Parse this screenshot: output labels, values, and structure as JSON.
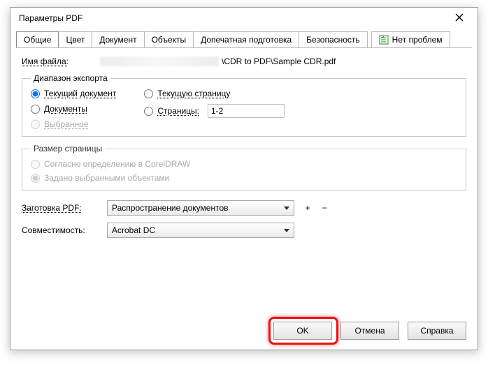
{
  "window": {
    "title": "Параметры PDF"
  },
  "tabs": {
    "t0": "Общие",
    "t1": "Цвет",
    "t2": "Документ",
    "t3": "Объекты",
    "t4": "Допечатная подготовка",
    "t5": "Безопасность",
    "status": "Нет проблем"
  },
  "filename": {
    "label": "Имя файла:",
    "value_suffix": "\\CDR to PDF\\Sample CDR.pdf"
  },
  "export_range": {
    "legend": "Диапазон экспорта",
    "current_doc": "Текущий документ",
    "current_page": "Текущую страницу",
    "documents": "Документы",
    "pages": "Страницы:",
    "selection": "Выбранное",
    "pages_value": "1-2"
  },
  "page_size": {
    "legend": "Размер страницы",
    "by_definition": "Согласно определению в CorelDRAW",
    "by_selected": "Задано выбранными объектами"
  },
  "preset": {
    "label": "Заготовка PDF:",
    "value": "Распространение документов"
  },
  "compat": {
    "label": "Совместимость:",
    "value": "Acrobat DC"
  },
  "buttons": {
    "ok": "OK",
    "cancel": "Отмена",
    "help": "Справка",
    "plus": "+",
    "minus": "−"
  }
}
